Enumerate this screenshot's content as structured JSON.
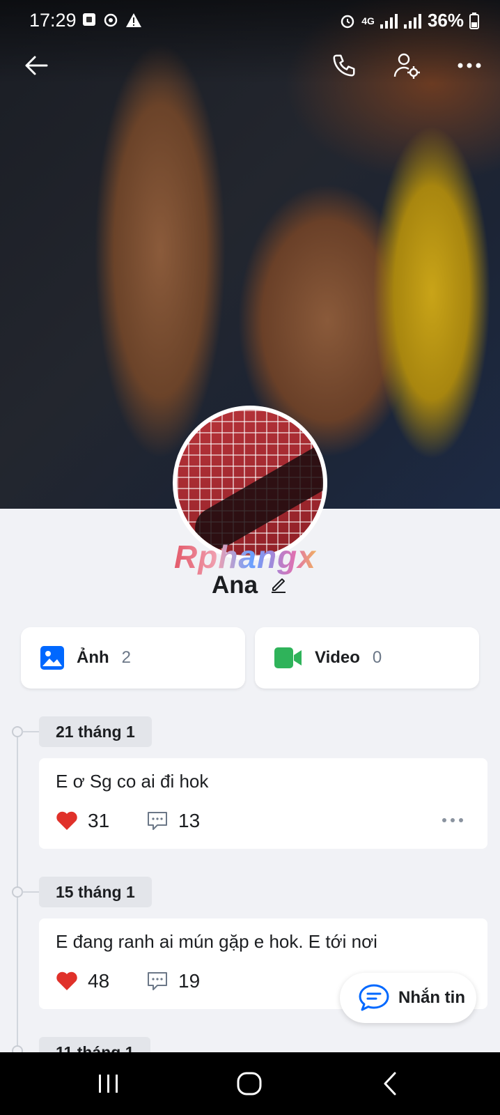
{
  "status_bar": {
    "time": "17:29",
    "battery": "36%",
    "network": "4G"
  },
  "topbar": {
    "back_icon": "arrow-left-icon",
    "call_icon": "phone-icon",
    "settings_icon": "user-settings-icon",
    "more_icon": "more-horizontal-icon"
  },
  "profile": {
    "name": "Ana",
    "watermark": "Rphangx"
  },
  "media": {
    "photos_label": "Ảnh",
    "photos_count": "2",
    "videos_label": "Video",
    "videos_count": "0"
  },
  "posts": [
    {
      "date": "21 tháng 1",
      "text": "E ơ Sg co ai đi hok",
      "likes": "31",
      "comments": "13"
    },
    {
      "date": "15 tháng 1",
      "text": "E đang ranh ai mún gặp e hok. E tới nơi",
      "likes": "48",
      "comments": "19"
    },
    {
      "date": "11 tháng 1"
    }
  ],
  "message_button": {
    "label": "Nhắn tin"
  },
  "colors": {
    "accent": "#0068ff",
    "heart": "#e0312a",
    "video": "#2fb35a"
  }
}
